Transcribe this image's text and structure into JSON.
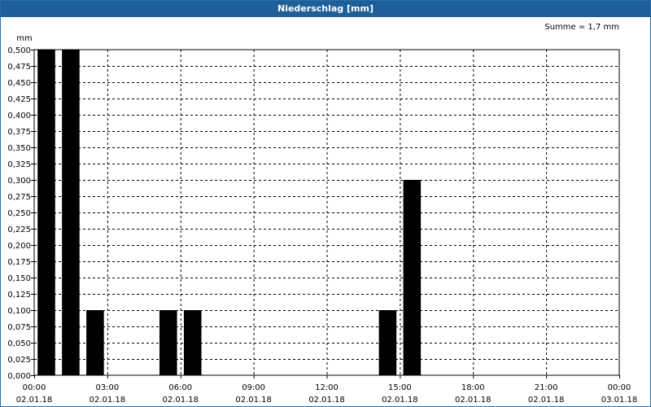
{
  "window": {
    "title": "Niederschlag [mm]"
  },
  "chart_data": {
    "type": "bar",
    "title": "Niederschlag [mm]",
    "ylabel": "mm",
    "annotation": "Summe = 1,7 mm",
    "ylim": [
      0,
      0.5
    ],
    "y_ticks": [
      "0,000",
      "0,025",
      "0,050",
      "0,075",
      "0,100",
      "0,125",
      "0,150",
      "0,175",
      "0,200",
      "0,225",
      "0,250",
      "0,275",
      "0,300",
      "0,325",
      "0,350",
      "0,375",
      "0,400",
      "0,425",
      "0,450",
      "0,475",
      "0,500"
    ],
    "x_ticks": [
      {
        "time": "00:00",
        "date": "02.01.18"
      },
      {
        "time": "03:00",
        "date": "02.01.18"
      },
      {
        "time": "06:00",
        "date": "02.01.18"
      },
      {
        "time": "09:00",
        "date": "02.01.18"
      },
      {
        "time": "12:00",
        "date": "02.01.18"
      },
      {
        "time": "15:00",
        "date": "02.01.18"
      },
      {
        "time": "18:00",
        "date": "02.01.18"
      },
      {
        "time": "21:00",
        "date": "02.01.18"
      },
      {
        "time": "00:00",
        "date": "03.01.18"
      }
    ],
    "x_range": [
      "02.01.18 00:00",
      "03.01.18 00:00"
    ],
    "bar_interval_hours": 1,
    "bars": [
      {
        "start": "00:00",
        "value": 0.5
      },
      {
        "start": "01:00",
        "value": 0.5
      },
      {
        "start": "02:00",
        "value": 0.1
      },
      {
        "start": "05:00",
        "value": 0.1
      },
      {
        "start": "06:00",
        "value": 0.1
      },
      {
        "start": "14:00",
        "value": 0.1
      },
      {
        "start": "15:00",
        "value": 0.3
      }
    ],
    "grid": true,
    "colors": {
      "bar": "#000000",
      "title_bar": "#1f5f99",
      "grid": "#000000"
    }
  }
}
